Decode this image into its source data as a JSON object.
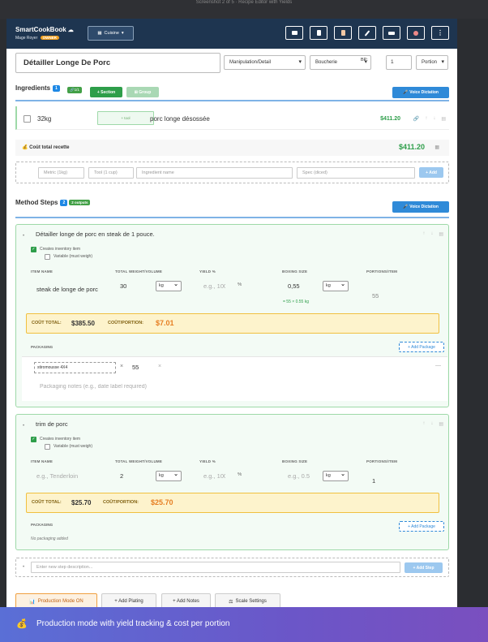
{
  "os_title": "Screenshot 2 of 5 · Recipe Editor with Yields",
  "app": {
    "brand": "SmartCookBook",
    "user": "Mage Royer",
    "role_badge": "OWNER",
    "cuisine_label": "Cuisine"
  },
  "recipe": {
    "title": "Détailler Longe De Porc",
    "category": "Manipulation/Detail",
    "station": "Boucherie",
    "bp_label": "BP:",
    "bp_value": "1",
    "portion_unit": "Portion"
  },
  "ingredients": {
    "heading": "Ingredients",
    "count": "1",
    "linked_badge": "1/1",
    "add_section_label": "+ Section",
    "group_label": "Group",
    "voice_label": "Voice Dictation",
    "rows": [
      {
        "qty": "32kg",
        "tool": "+ tool",
        "name": "porc longe désossée",
        "price": "$411.20"
      }
    ],
    "total_label": "Coût total recette",
    "total_value": "$411.20",
    "new_row": {
      "metric_ph": "Metric (1kg)",
      "tool_ph": "Tool (1 cup)",
      "name_ph": "Ingredient name",
      "spec_ph": "Spec (diced)",
      "add_label": "+ Add"
    }
  },
  "method": {
    "heading": "Method Steps",
    "count": "2",
    "outputs_badge": "2 outputs",
    "voice_label": "Voice Dictation",
    "col_item": "ITEM NAME",
    "col_weight": "TOTAL WEIGHT/VOLUME",
    "col_yield": "YIELD %",
    "col_boxing": "BOXING SIZE",
    "col_portions": "PORTIONS/ITEM",
    "creates_label": "Creates inventory item",
    "variable_label": "Variable (must weigh)",
    "cost_total_label": "COÛT TOTAL:",
    "cost_portion_label": "COÛT/PORTION:",
    "packaging_label": "PACKAGING",
    "add_package_label": "+ Add Package",
    "steps": [
      {
        "title": "Détailler longe de porc en steak de 1 pouce.",
        "item_name": "steak de longe de porc",
        "weight": "30",
        "weight_unit": "kg",
        "yield_ph": "e.g., 100",
        "percent": "%",
        "boxing": "0,55",
        "boxing_unit": "kg",
        "boxing_hint": "= 55 × 0.55 kg",
        "portions": "55",
        "cost_total": "$385.50",
        "cost_portion": "$7.01",
        "package_name": "stiromousse 4X4",
        "package_qty": "55",
        "times": "×",
        "remove_glyph": "×",
        "collapse_glyph": "—",
        "notes_ph": "Packaging notes (e.g., date label required)"
      },
      {
        "title": "trim de porc",
        "item_name_ph": "e.g., Tenderloin",
        "weight": "2",
        "weight_unit": "kg",
        "yield_ph": "e.g., 100",
        "percent": "%",
        "boxing_ph": "e.g., 0.5",
        "boxing_unit": "kg",
        "portions": "1",
        "cost_total": "$25.70",
        "cost_portion": "$25.70",
        "no_packaging": "No packaging added"
      }
    ],
    "new_step_ph": "Enter new step description...",
    "add_step_label": "+ Add Step"
  },
  "bottom_bar": {
    "production_label": "Production Mode ON",
    "plating_label": "+ Add Plating",
    "notes_label": "+ Add Notes",
    "scale_label": "Scale Settings"
  },
  "toast": {
    "text": "Production mode with yield tracking & cost per portion"
  },
  "colors": {
    "header_bg": "#1e3550",
    "accent_green": "#2e9e4a",
    "accent_blue": "#2f8ad8",
    "cost_orange": "#e67e22",
    "cost_bg": "#fdf3cc"
  }
}
